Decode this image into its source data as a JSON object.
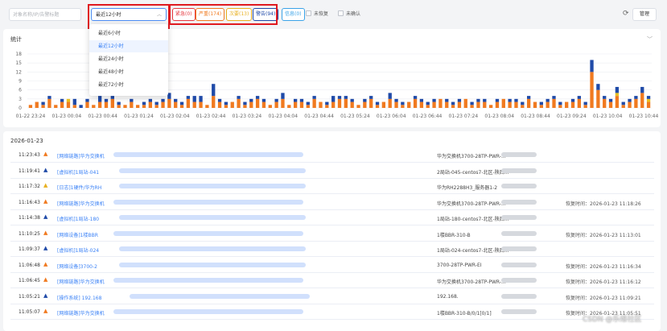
{
  "toolbar": {
    "search_placeholder": "对象名称/IP/告警标题",
    "time_value": "最近12小时",
    "levels": [
      {
        "label": "紧急(0)",
        "color": "#e6393f"
      },
      {
        "label": "严重(174)",
        "color": "#f07a20"
      },
      {
        "label": "次要(13)",
        "color": "#e8b020"
      },
      {
        "label": "警告(94)",
        "color": "#1f4aa8"
      },
      {
        "label": "信息(0)",
        "color": "#3ba3e8"
      }
    ],
    "unrecovered": "未恢复",
    "unconfirmed": "未确认",
    "manage": "管理"
  },
  "time_options": [
    "最近6小时",
    "最近12小时",
    "最近24小时",
    "最近48小时",
    "最近72小时"
  ],
  "chart_panel": {
    "title": "统计"
  },
  "chart_data": {
    "type": "bar",
    "stacked": true,
    "ylim": [
      0,
      18
    ],
    "yticks": [
      0,
      3,
      6,
      9,
      12,
      15,
      18
    ],
    "xtick_labels": [
      "01-22 23:24",
      "01-23 00:04",
      "01-23 00:44",
      "01-23 01:24",
      "01-23 02:04",
      "01-23 02:44",
      "01-23 03:24",
      "01-23 04:04",
      "01-23 04:44",
      "01-23 05:24",
      "01-23 06:04",
      "01-23 06:44",
      "01-23 07:24",
      "01-23 08:04",
      "01-23 08:44",
      "01-23 09:24",
      "01-23 10:04",
      "01-23 10:44"
    ],
    "series": [
      {
        "color": "#f07a20",
        "values": [
          1,
          2,
          1,
          3,
          1,
          2,
          2,
          1,
          0,
          2,
          1,
          2,
          2,
          3,
          1,
          1,
          2,
          1,
          1,
          2,
          1,
          2,
          3,
          2,
          1,
          3,
          2,
          2,
          1,
          4,
          2,
          1,
          2,
          3,
          1,
          2,
          3,
          2,
          1,
          2,
          3,
          1,
          2,
          2,
          1,
          3,
          2,
          1,
          2,
          3,
          3,
          2,
          1,
          2,
          3,
          1,
          2,
          3,
          2,
          1,
          2,
          3,
          2,
          1,
          2,
          3,
          2,
          1,
          2,
          3,
          1,
          2,
          2,
          1,
          2,
          3,
          2,
          2,
          1,
          3,
          2,
          1,
          2,
          3,
          1,
          2,
          2,
          3,
          1,
          12,
          6,
          3,
          2,
          4,
          1,
          2,
          3,
          5,
          2
        ]
      },
      {
        "color": "#e8c020",
        "values": [
          0,
          0,
          0,
          0,
          0,
          0,
          1,
          0,
          0,
          0,
          0,
          0,
          0,
          0,
          0,
          0,
          0,
          0,
          0,
          0,
          0,
          0,
          0,
          0,
          0,
          0,
          0,
          0,
          0,
          0,
          0,
          0,
          0,
          0,
          0,
          0,
          0,
          0,
          0,
          0,
          0,
          0,
          0,
          0,
          0,
          0,
          0,
          0,
          0,
          0,
          0,
          0,
          0,
          0,
          0,
          0,
          0,
          0,
          0,
          0,
          0,
          0,
          0,
          0,
          0,
          0,
          0,
          0,
          0,
          0,
          0,
          0,
          0,
          0,
          0,
          0,
          0,
          0,
          0,
          0,
          0,
          0,
          0,
          0,
          0,
          0,
          0,
          0,
          0,
          0,
          0,
          0,
          0,
          1,
          0,
          0,
          0,
          0,
          1
        ]
      },
      {
        "color": "#1f4aa8",
        "values": [
          0,
          0,
          1,
          1,
          0,
          1,
          0,
          2,
          1,
          1,
          0,
          2,
          1,
          1,
          1,
          0,
          1,
          0,
          1,
          1,
          1,
          1,
          2,
          1,
          1,
          1,
          2,
          2,
          0,
          4,
          1,
          1,
          0,
          1,
          1,
          1,
          1,
          1,
          0,
          1,
          2,
          0,
          1,
          1,
          1,
          1,
          0,
          1,
          2,
          1,
          1,
          1,
          0,
          1,
          1,
          1,
          0,
          2,
          1,
          1,
          0,
          1,
          1,
          1,
          1,
          0,
          1,
          1,
          1,
          0,
          1,
          1,
          1,
          0,
          1,
          0,
          1,
          1,
          1,
          1,
          0,
          1,
          1,
          1,
          1,
          0,
          1,
          1,
          1,
          4,
          2,
          1,
          1,
          2,
          1,
          1,
          1,
          2,
          1
        ]
      }
    ]
  },
  "list": {
    "date": "2026-01-23",
    "rows": [
      {
        "time": "11:23:43",
        "sev": "#f07a20",
        "title": "[网络链路]华为交换机",
        "host": "华为交换机3700-28TP-PWR-...",
        "recovery": ""
      },
      {
        "time": "11:19:41",
        "sev": "#1f4aa8",
        "title": "[虚拟机]1局站-041",
        "host": "2局站-045-centos7-北区-陕西...",
        "recovery": ""
      },
      {
        "time": "11:17:32",
        "sev": "#e8b020",
        "title": "[日志]1硬件/华为RH",
        "host": "华为RH2288H3_服务器1-2",
        "recovery": ""
      },
      {
        "time": "11:16:43",
        "sev": "#f07a20",
        "title": "[网络链路]华为交换机",
        "host": "华为交换机3700-28TP-PWR-...",
        "recovery": "恢复时间：2026-01-23 11:18:26"
      },
      {
        "time": "11:14:38",
        "sev": "#1f4aa8",
        "title": "[虚拟机]1局站-180",
        "host": "1局站-180-centos7-北区-陕西...",
        "recovery": ""
      },
      {
        "time": "11:10:25",
        "sev": "#f07a20",
        "title": "[网络设备]1楼BBR",
        "host": "1楼BBR-310-B",
        "recovery": "恢复时间：2026-01-23 11:13:01"
      },
      {
        "time": "11:09:37",
        "sev": "#1f4aa8",
        "title": "[虚拟机]1局站-024",
        "host": "1局站-024-centos7-北区-陕西...",
        "recovery": ""
      },
      {
        "time": "11:06:48",
        "sev": "#f07a20",
        "title": "[网络设备]3700-2",
        "host": "3700-28TP-PWR-EI",
        "recovery": "恢复时间：2026-01-23 11:16:34"
      },
      {
        "time": "11:06:45",
        "sev": "#f07a20",
        "title": "[网络链路]华为交换机",
        "host": "华为交换机3700-28TP-PWR-...",
        "recovery": "恢复时间：2026-01-23 11:16:12"
      },
      {
        "time": "11:05:21",
        "sev": "#1f4aa8",
        "title": "[操作系统] 192.168",
        "host": "192.168.",
        "recovery": "恢复时间：2026-01-23 11:09:21"
      },
      {
        "time": "11:05:07",
        "sev": "#f07a20",
        "title": "[网络链路]华为交换机",
        "host": "1楼BBR-310-B/0/1[0/1]",
        "recovery": "恢复时间：2026-01-23 11:05:51"
      }
    ]
  },
  "watermark": "CSDN @乐维社区"
}
